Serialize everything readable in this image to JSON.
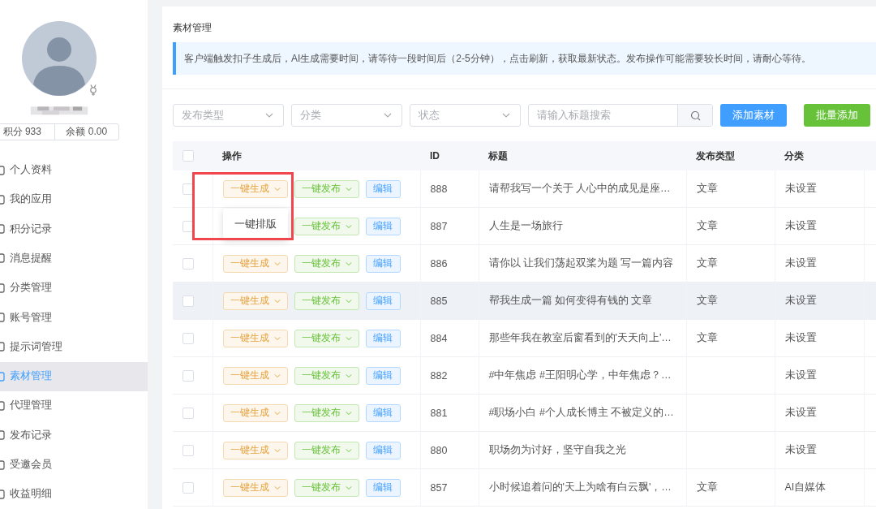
{
  "sidebar": {
    "stats": [
      {
        "label": "积分 933"
      },
      {
        "label": "余额 0.00"
      }
    ],
    "menu": [
      {
        "label": "个人资料",
        "selected": false
      },
      {
        "label": "我的应用",
        "selected": false
      },
      {
        "label": "积分记录",
        "selected": false
      },
      {
        "label": "消息提醒",
        "selected": false
      },
      {
        "label": "分类管理",
        "selected": false
      },
      {
        "label": "账号管理",
        "selected": false
      },
      {
        "label": "提示词管理",
        "selected": false
      },
      {
        "label": "素材管理",
        "selected": true
      },
      {
        "label": "代理管理",
        "selected": false
      },
      {
        "label": "发布记录",
        "selected": false
      },
      {
        "label": "受邀会员",
        "selected": false
      },
      {
        "label": "收益明细",
        "selected": false
      }
    ]
  },
  "main": {
    "title": "素材管理",
    "notice": "客户端触发扣子生成后，AI生成需要时间，请等待一段时间后（2-5分钟），点击刷新，获取最新状态。发布操作可能需要较长时间，请耐心等待。",
    "filters": [
      {
        "kind": "select",
        "placeholder": "发布类型"
      },
      {
        "kind": "select",
        "placeholder": "分类"
      },
      {
        "kind": "select",
        "placeholder": "状态"
      },
      {
        "kind": "search",
        "placeholder": "请输入标题搜索"
      }
    ],
    "buttons": [
      {
        "kind": "primary",
        "label": "添加素材"
      },
      {
        "kind": "success",
        "label": "批量添加"
      }
    ],
    "table": {
      "select_all_checked": false,
      "columns": [
        "操作",
        "ID",
        "标题",
        "发布类型",
        "分类"
      ],
      "rows": [
        {
          "checked": false,
          "hovered": false,
          "actions": [
            {
              "kind": "generate",
              "label": "一键生成"
            },
            {
              "kind": "publish",
              "label": "一键发布"
            },
            {
              "kind": "edit",
              "label": "编辑"
            }
          ],
          "id": "888",
          "title": "请帮我写一个关于 人心中的成见是座…",
          "type": "文章",
          "category": "未设置"
        },
        {
          "checked": false,
          "hovered": false,
          "actions": [
            {
              "kind": "publish",
              "label": "一键发布"
            },
            {
              "kind": "edit",
              "label": "编辑"
            }
          ],
          "id": "887",
          "title": "人生是一场旅行",
          "type": "文章",
          "category": "未设置"
        },
        {
          "checked": false,
          "hovered": false,
          "actions": [
            {
              "kind": "generate",
              "label": "一键生成"
            },
            {
              "kind": "publish",
              "label": "一键发布"
            },
            {
              "kind": "edit",
              "label": "编辑"
            }
          ],
          "id": "886",
          "title": "请你以 让我们荡起双桨为题 写一篇内容",
          "type": "文章",
          "category": "未设置"
        },
        {
          "checked": false,
          "hovered": true,
          "actions": [
            {
              "kind": "generate",
              "label": "一键生成"
            },
            {
              "kind": "publish",
              "label": "一键发布"
            },
            {
              "kind": "edit",
              "label": "编辑"
            }
          ],
          "id": "885",
          "title": "帮我生成一篇 如何变得有钱的 文章",
          "type": "文章",
          "category": "未设置"
        },
        {
          "checked": false,
          "hovered": false,
          "actions": [
            {
              "kind": "generate",
              "label": "一键生成"
            },
            {
              "kind": "publish",
              "label": "一键发布"
            },
            {
              "kind": "edit",
              "label": "编辑"
            }
          ],
          "id": "884",
          "title": "那些年我在教室后窗看到的'天天向上'…",
          "type": "文章",
          "category": "未设置"
        },
        {
          "checked": false,
          "hovered": false,
          "actions": [
            {
              "kind": "generate",
              "label": "一键生成"
            },
            {
              "kind": "publish",
              "label": "一键发布"
            },
            {
              "kind": "edit",
              "label": "编辑"
            }
          ],
          "id": "882",
          "title": "#中年焦虑 #王阳明心学，中年焦虑？…",
          "category": "未设置"
        },
        {
          "checked": false,
          "hovered": false,
          "actions": [
            {
              "kind": "generate",
              "label": "一键生成"
            },
            {
              "kind": "publish",
              "label": "一键发布"
            },
            {
              "kind": "edit",
              "label": "编辑"
            }
          ],
          "id": "881",
          "title": "#职场小白 #个人成长博主 不被定义的…",
          "category": "未设置"
        },
        {
          "checked": false,
          "hovered": false,
          "actions": [
            {
              "kind": "generate",
              "label": "一键生成"
            },
            {
              "kind": "publish",
              "label": "一键发布"
            },
            {
              "kind": "edit",
              "label": "编辑"
            }
          ],
          "id": "880",
          "title": "职场勿为讨好，坚守自我之光",
          "category": "未设置"
        },
        {
          "checked": false,
          "hovered": false,
          "actions": [
            {
              "kind": "generate",
              "label": "一键生成"
            },
            {
              "kind": "publish",
              "label": "一键发布"
            },
            {
              "kind": "edit",
              "label": "编辑"
            }
          ],
          "id": "857",
          "title": "小时候追着问的'天上为啥有白云飘'，…",
          "type": "文章",
          "category": "AI自媒体"
        }
      ]
    },
    "dropdown": {
      "items": [
        "一键排版"
      ],
      "highlighted": true
    }
  }
}
